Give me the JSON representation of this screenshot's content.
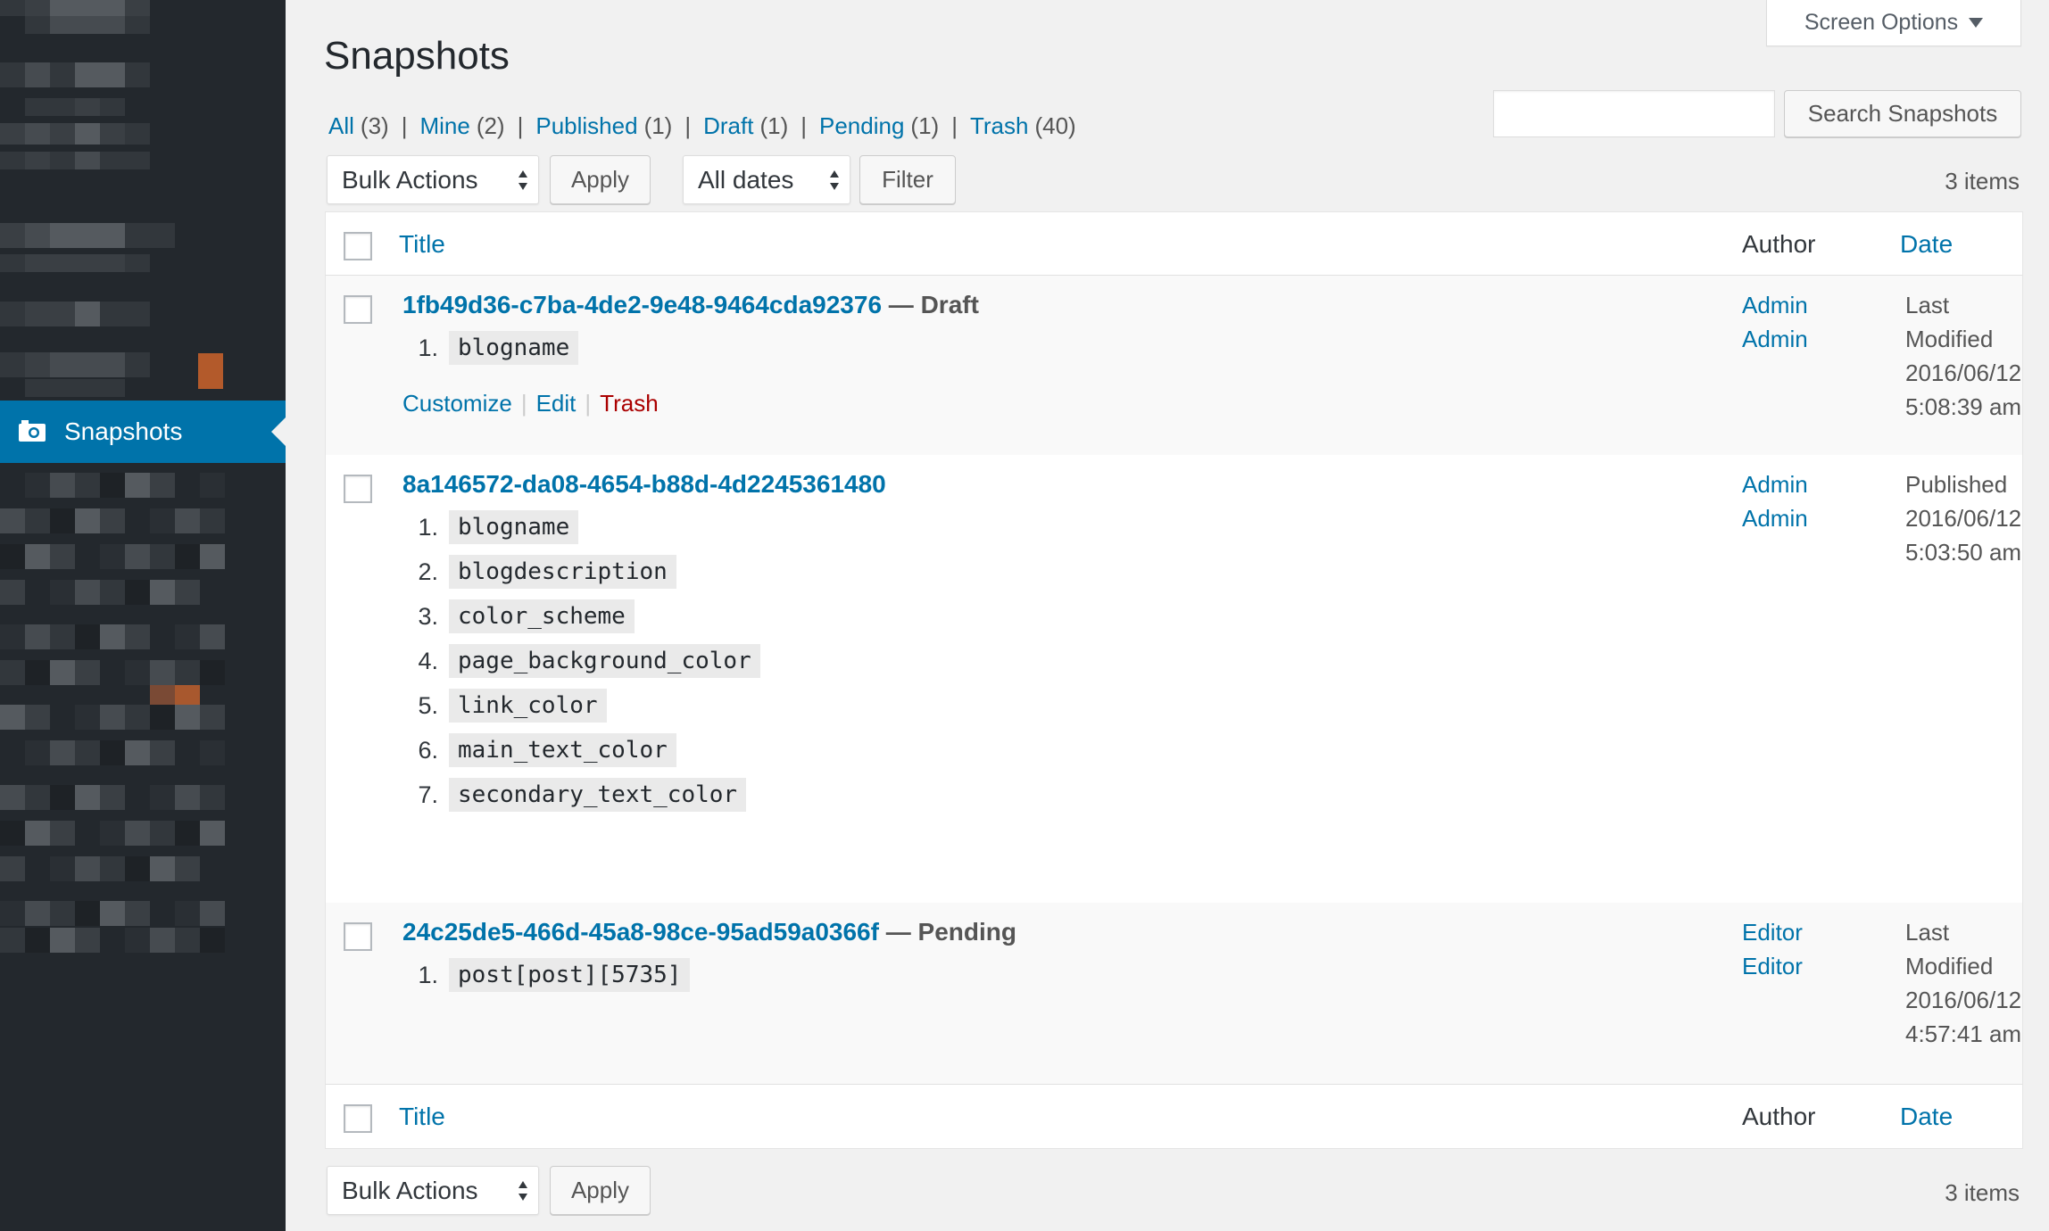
{
  "sidebar": {
    "active_item": {
      "label": "Snapshots",
      "icon": "camera-icon"
    }
  },
  "header": {
    "title": "Snapshots",
    "screen_options": "Screen Options"
  },
  "views": [
    {
      "label": "All",
      "count": "(3)"
    },
    {
      "label": "Mine",
      "count": "(2)"
    },
    {
      "label": "Published",
      "count": "(1)"
    },
    {
      "label": "Draft",
      "count": "(1)"
    },
    {
      "label": "Pending",
      "count": "(1)"
    },
    {
      "label": "Trash",
      "count": "(40)"
    }
  ],
  "view_separator": "|",
  "search": {
    "value": "",
    "button_label": "Search Snapshots"
  },
  "tablenav_top": {
    "bulk_actions": "Bulk Actions",
    "apply": "Apply",
    "dates": "All dates",
    "filter": "Filter",
    "items_count": "3 items"
  },
  "table": {
    "columns": {
      "title": "Title",
      "author": "Author",
      "date": "Date"
    },
    "rows": [
      {
        "title": "1fb49d36-c7ba-4de2-9e48-9464cda92376",
        "state": " — Draft",
        "settings": [
          "blogname"
        ],
        "actions": {
          "customize": "Customize",
          "edit": "Edit",
          "trash": "Trash",
          "separator": "|"
        },
        "authors": [
          "Admin",
          "Admin"
        ],
        "date_lines": [
          "Last",
          "Modified",
          "2016/06/12",
          "5:08:39 am"
        ]
      },
      {
        "title": "8a146572-da08-4654-b88d-4d2245361480",
        "state": "",
        "settings": [
          "blogname",
          "blogdescription",
          "color_scheme",
          "page_background_color",
          "link_color",
          "main_text_color",
          "secondary_text_color"
        ],
        "authors": [
          "Admin",
          "Admin"
        ],
        "date_lines": [
          "Published",
          "2016/06/12",
          "5:03:50 am"
        ]
      },
      {
        "title": "24c25de5-466d-45a8-98ce-95ad59a0366f",
        "state": " — Pending",
        "settings": [
          "post[post][5735]"
        ],
        "authors": [
          "Editor",
          "Editor"
        ],
        "date_lines": [
          "Last",
          "Modified",
          "2016/06/12",
          "4:57:41 am"
        ]
      }
    ]
  },
  "tablenav_bottom": {
    "bulk_actions": "Bulk Actions",
    "apply": "Apply",
    "items_count": "3 items"
  },
  "colors": {
    "sidebar_bg": "#23282d",
    "active_menu_bg": "#0073aa",
    "link": "#0073aa",
    "trash_link": "#aa0000",
    "page_bg": "#f1f1f1"
  }
}
